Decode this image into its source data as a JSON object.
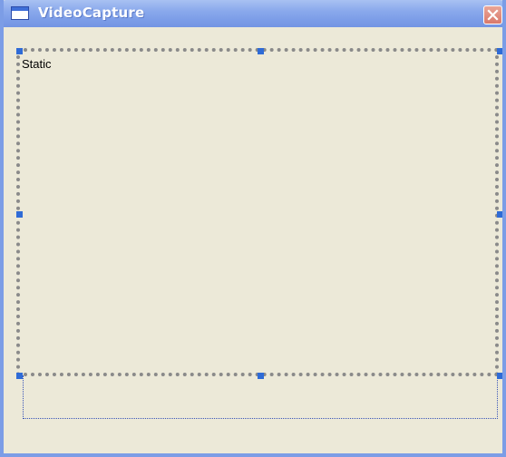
{
  "window": {
    "title": "VideoCapture",
    "icon": "window-icon",
    "close_icon": "close-icon"
  },
  "static_control": {
    "label": "Static"
  },
  "colors": {
    "title_bar": "#7d9ee8",
    "client_area": "#ece9d8",
    "selection_handle": "#2f6bd6"
  }
}
